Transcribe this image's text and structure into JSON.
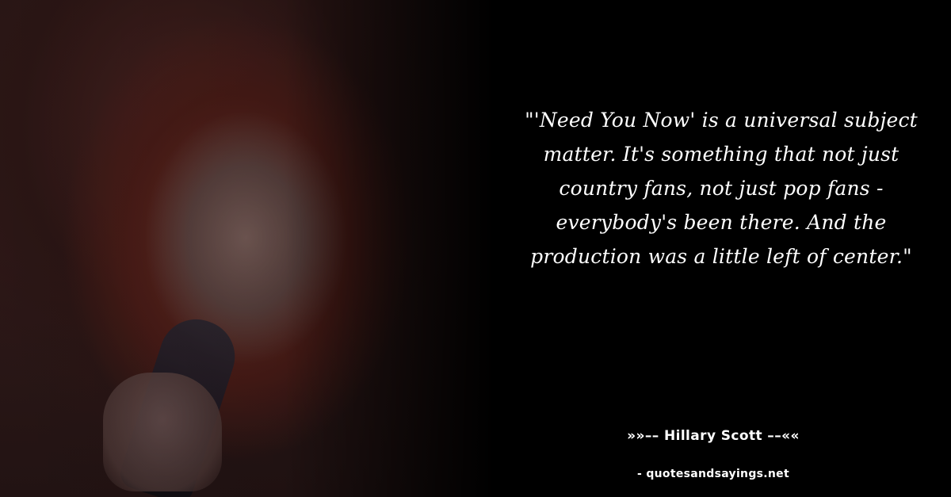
{
  "quote": {
    "text": "\"'Need You Now' is a universal subject matter. It's something that not just country fans, not just pop fans - everybody's been there. And the production was a little left of center.\""
  },
  "author": {
    "line": "»»–– Hillary Scott ––««"
  },
  "footer": {
    "site": "- quotesandsayings.net"
  },
  "colors": {
    "background": "#000000",
    "text": "#ffffff"
  }
}
